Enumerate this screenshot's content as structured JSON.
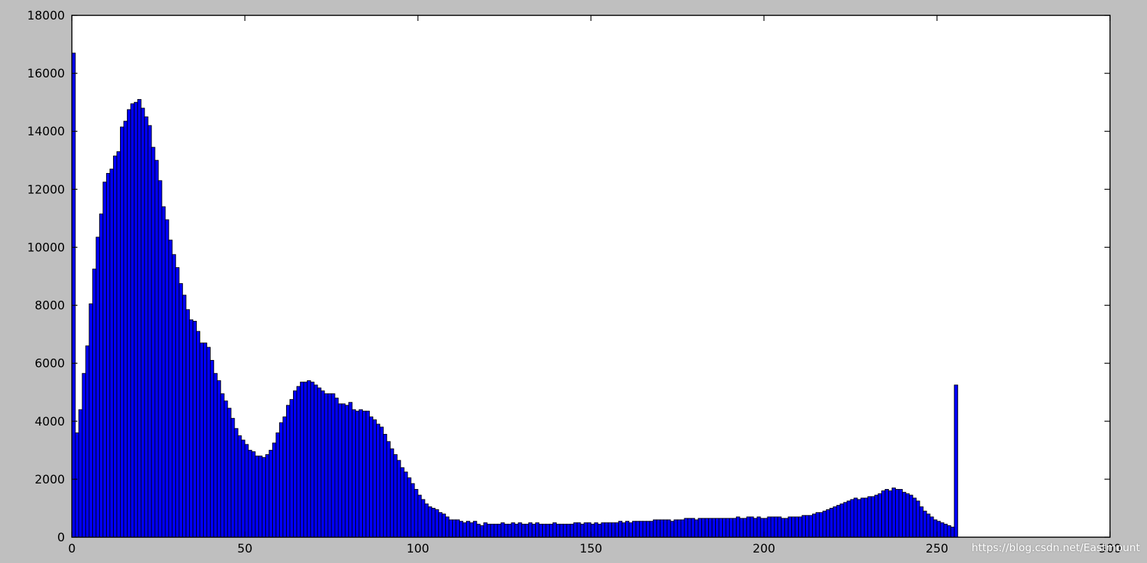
{
  "chart_data": {
    "type": "bar",
    "title": "",
    "xlabel": "",
    "ylabel": "",
    "xlim": [
      0,
      300
    ],
    "ylim": [
      0,
      18000
    ],
    "xticks": [
      0,
      50,
      100,
      150,
      200,
      250,
      300
    ],
    "yticks": [
      0,
      2000,
      4000,
      6000,
      8000,
      10000,
      12000,
      14000,
      16000,
      18000
    ],
    "grid": false,
    "legend": "none",
    "bar_color": "#0000ff",
    "edge_color": "#000000",
    "bin_width": 1,
    "x": [
      0,
      1,
      2,
      3,
      4,
      5,
      6,
      7,
      8,
      9,
      10,
      11,
      12,
      13,
      14,
      15,
      16,
      17,
      18,
      19,
      20,
      21,
      22,
      23,
      24,
      25,
      26,
      27,
      28,
      29,
      30,
      31,
      32,
      33,
      34,
      35,
      36,
      37,
      38,
      39,
      40,
      41,
      42,
      43,
      44,
      45,
      46,
      47,
      48,
      49,
      50,
      51,
      52,
      53,
      54,
      55,
      56,
      57,
      58,
      59,
      60,
      61,
      62,
      63,
      64,
      65,
      66,
      67,
      68,
      69,
      70,
      71,
      72,
      73,
      74,
      75,
      76,
      77,
      78,
      79,
      80,
      81,
      82,
      83,
      84,
      85,
      86,
      87,
      88,
      89,
      90,
      91,
      92,
      93,
      94,
      95,
      96,
      97,
      98,
      99,
      100,
      101,
      102,
      103,
      104,
      105,
      106,
      107,
      108,
      109,
      110,
      111,
      112,
      113,
      114,
      115,
      116,
      117,
      118,
      119,
      120,
      121,
      122,
      123,
      124,
      125,
      126,
      127,
      128,
      129,
      130,
      131,
      132,
      133,
      134,
      135,
      136,
      137,
      138,
      139,
      140,
      141,
      142,
      143,
      144,
      145,
      146,
      147,
      148,
      149,
      150,
      151,
      152,
      153,
      154,
      155,
      156,
      157,
      158,
      159,
      160,
      161,
      162,
      163,
      164,
      165,
      166,
      167,
      168,
      169,
      170,
      171,
      172,
      173,
      174,
      175,
      176,
      177,
      178,
      179,
      180,
      181,
      182,
      183,
      184,
      185,
      186,
      187,
      188,
      189,
      190,
      191,
      192,
      193,
      194,
      195,
      196,
      197,
      198,
      199,
      200,
      201,
      202,
      203,
      204,
      205,
      206,
      207,
      208,
      209,
      210,
      211,
      212,
      213,
      214,
      215,
      216,
      217,
      218,
      219,
      220,
      221,
      222,
      223,
      224,
      225,
      226,
      227,
      228,
      229,
      230,
      231,
      232,
      233,
      234,
      235,
      236,
      237,
      238,
      239,
      240,
      241,
      242,
      243,
      244,
      245,
      246,
      247,
      248,
      249,
      250,
      251,
      252,
      253,
      254,
      255
    ],
    "values": [
      16700,
      3600,
      4400,
      5650,
      6600,
      8050,
      9250,
      10350,
      11150,
      12250,
      12550,
      12700,
      13150,
      13300,
      14150,
      14350,
      14750,
      14950,
      15000,
      15100,
      14800,
      14500,
      14200,
      13450,
      13000,
      12300,
      11400,
      10950,
      10250,
      9750,
      9300,
      8750,
      8350,
      7850,
      7500,
      7450,
      7100,
      6700,
      6700,
      6550,
      6100,
      5650,
      5400,
      4950,
      4700,
      4450,
      4100,
      3750,
      3500,
      3350,
      3200,
      3000,
      2950,
      2800,
      2800,
      2750,
      2850,
      3000,
      3250,
      3600,
      3950,
      4150,
      4550,
      4750,
      5050,
      5200,
      5350,
      5350,
      5400,
      5350,
      5250,
      5150,
      5050,
      4950,
      4950,
      4950,
      4800,
      4600,
      4600,
      4550,
      4650,
      4400,
      4350,
      4400,
      4350,
      4350,
      4150,
      4050,
      3900,
      3800,
      3550,
      3300,
      3050,
      2850,
      2650,
      2400,
      2250,
      2050,
      1850,
      1650,
      1450,
      1300,
      1150,
      1050,
      1000,
      950,
      850,
      800,
      700,
      600,
      600,
      600,
      550,
      500,
      550,
      500,
      550,
      450,
      400,
      500,
      450,
      450,
      450,
      450,
      500,
      450,
      450,
      500,
      450,
      500,
      450,
      450,
      500,
      450,
      500,
      450,
      450,
      450,
      450,
      500,
      450,
      450,
      450,
      450,
      450,
      500,
      500,
      450,
      500,
      500,
      450,
      500,
      450,
      500,
      500,
      500,
      500,
      500,
      550,
      500,
      550,
      500,
      550,
      550,
      550,
      550,
      550,
      550,
      600,
      600,
      600,
      600,
      600,
      550,
      600,
      600,
      600,
      650,
      650,
      650,
      600,
      650,
      650,
      650,
      650,
      650,
      650,
      650,
      650,
      650,
      650,
      650,
      700,
      650,
      650,
      700,
      700,
      650,
      700,
      650,
      650,
      700,
      700,
      700,
      700,
      650,
      650,
      700,
      700,
      700,
      700,
      750,
      750,
      750,
      800,
      850,
      850,
      900,
      950,
      1000,
      1050,
      1100,
      1150,
      1200,
      1250,
      1300,
      1350,
      1300,
      1350,
      1350,
      1400,
      1400,
      1450,
      1500,
      1600,
      1650,
      1600,
      1700,
      1650,
      1650,
      1550,
      1500,
      1450,
      1350,
      1250,
      1050,
      900,
      800,
      700,
      600,
      550,
      500,
      450,
      400,
      350,
      5250
    ],
    "watermark": "https://blog.csdn.net/Eastmount"
  }
}
